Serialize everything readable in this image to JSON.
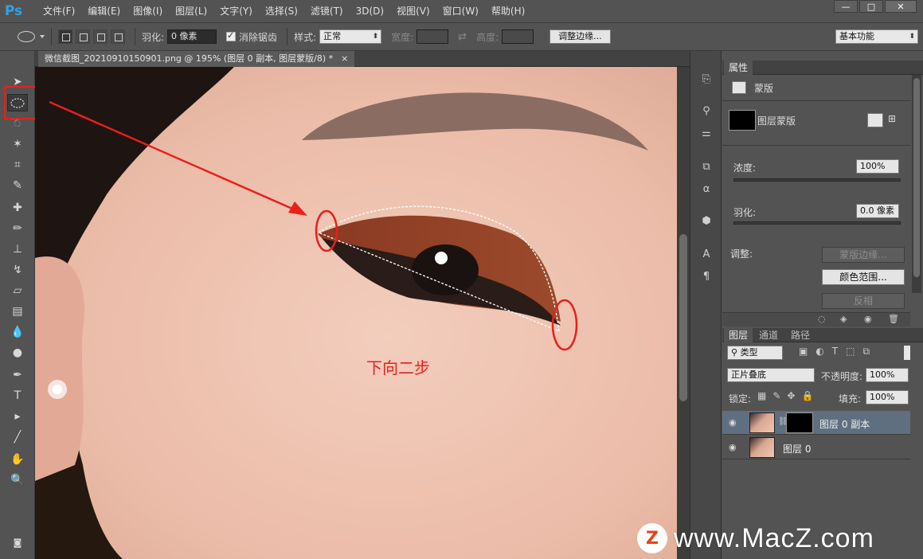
{
  "app": {
    "logo": "Ps",
    "menu": [
      "文件(F)",
      "编辑(E)",
      "图像(I)",
      "图层(L)",
      "文字(Y)",
      "选择(S)",
      "滤镜(T)",
      "3D(D)",
      "视图(V)",
      "窗口(W)",
      "帮助(H)"
    ],
    "window_buttons": [
      "—",
      "□",
      "✕"
    ]
  },
  "options": {
    "feather_label": "羽化:",
    "feather_value": "0 像素",
    "antialias_label": "消除锯齿",
    "style_label": "样式:",
    "style_value": "正常",
    "width_label": "宽度:",
    "height_label": "高度:",
    "refine_button": "调整边缘...",
    "workspace": "基本功能"
  },
  "document": {
    "tab_title": "微信截图_20210910150901.png @ 195% (图层 0 副本, 图层蒙版/8) *",
    "close": "×",
    "annotation": "下向二步",
    "annotation_color": "#e8201c"
  },
  "properties": {
    "tab": "属性",
    "mask_type": "蒙版",
    "layer_mask_label": "图层蒙版",
    "density_label": "浓度:",
    "density_value": "100%",
    "feather_label": "羽化:",
    "feather_value": "0.0 像素",
    "adjust_label": "调整:",
    "mask_edge_button": "蒙版边缘...",
    "color_range_button": "颜色范围...",
    "invert_button": "反相"
  },
  "layers": {
    "tabs": [
      "图层",
      "通道",
      "路径"
    ],
    "filter_kind": "类型",
    "blend_mode": "正片叠底",
    "opacity_label": "不透明度:",
    "opacity_value": "100%",
    "lock_label": "锁定:",
    "fill_label": "填充:",
    "fill_value": "100%",
    "items": [
      {
        "name": "图层 0 副本",
        "selected": true,
        "has_mask": true
      },
      {
        "name": "图层 0",
        "selected": false,
        "has_mask": false
      }
    ]
  },
  "watermark": {
    "letter": "Z",
    "text": "www.MacZ.com"
  }
}
